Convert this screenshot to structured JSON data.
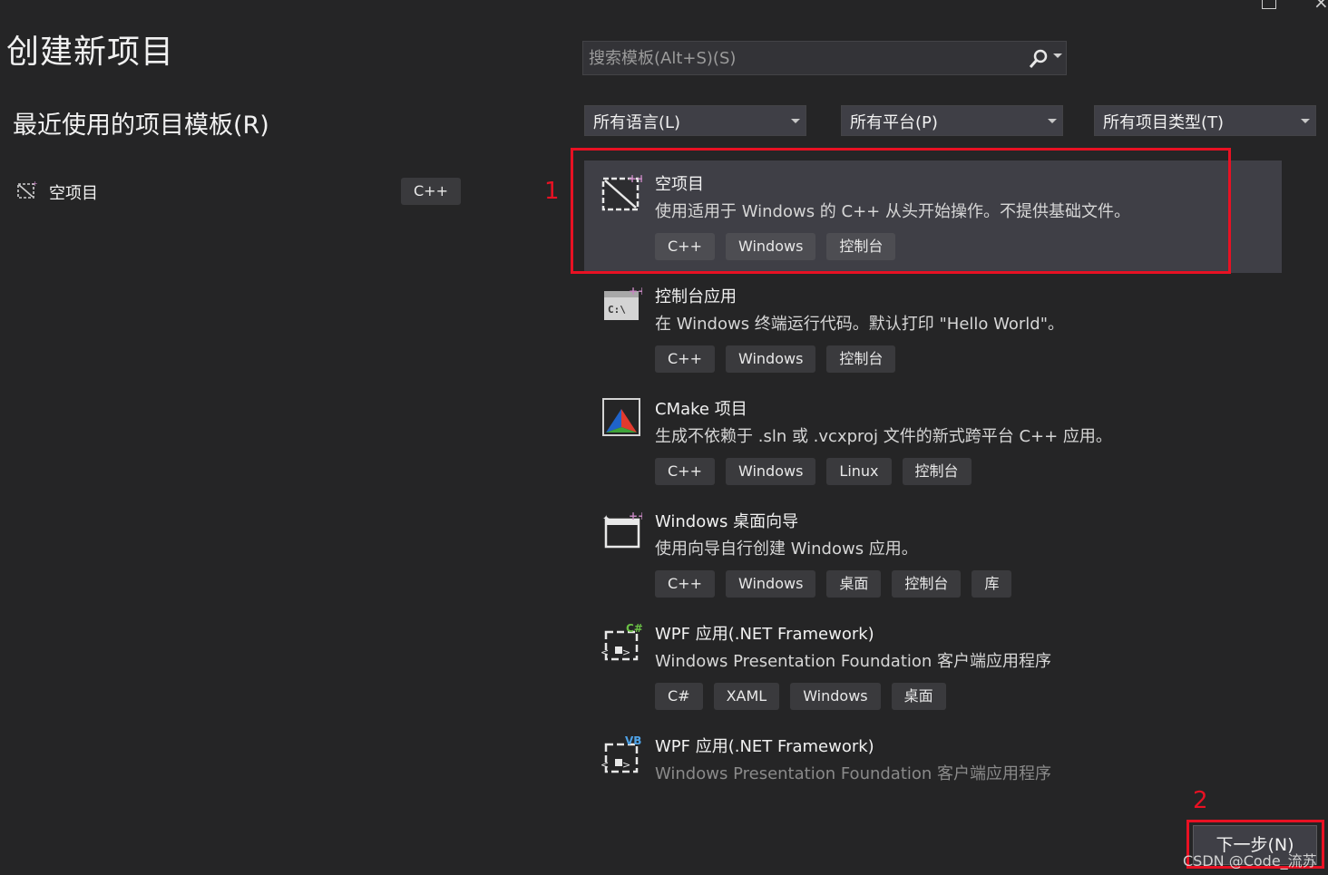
{
  "page_title": "创建新项目",
  "recent": {
    "title": "最近使用的项目模板(R)",
    "items": [
      {
        "label": "空项目",
        "tag": "C++",
        "icon": "empty-project-icon"
      }
    ]
  },
  "search": {
    "placeholder": "搜索模板(Alt+S)(S)",
    "icon": "search-icon"
  },
  "filters": {
    "language": "所有语言(L)",
    "platform": "所有平台(P)",
    "project_type": "所有项目类型(T)"
  },
  "templates": [
    {
      "name": "空项目",
      "desc": "使用适用于 Windows 的 C++ 从头开始操作。不提供基础文件。",
      "tags": [
        "C++",
        "Windows",
        "控制台"
      ],
      "icon": "empty-project-icon",
      "selected": true
    },
    {
      "name": "控制台应用",
      "desc": "在 Windows 终端运行代码。默认打印 \"Hello World\"。",
      "tags": [
        "C++",
        "Windows",
        "控制台"
      ],
      "icon": "console-app-icon"
    },
    {
      "name": "CMake 项目",
      "desc": "生成不依赖于 .sln 或 .vcxproj 文件的新式跨平台 C++ 应用。",
      "tags": [
        "C++",
        "Windows",
        "Linux",
        "控制台"
      ],
      "icon": "cmake-icon"
    },
    {
      "name": "Windows 桌面向导",
      "desc": "使用向导自行创建 Windows 应用。",
      "tags": [
        "C++",
        "Windows",
        "桌面",
        "控制台",
        "库"
      ],
      "icon": "desktop-wizard-icon"
    },
    {
      "name": "WPF 应用(.NET Framework)",
      "desc": "Windows Presentation Foundation 客户端应用程序",
      "tags": [
        "C#",
        "XAML",
        "Windows",
        "桌面"
      ],
      "icon": "wpf-csharp-icon"
    },
    {
      "name": "WPF 应用(.NET Framework)",
      "desc": "Windows Presentation Foundation 客户端应用程序",
      "tags": [],
      "icon": "wpf-vb-icon"
    }
  ],
  "annotations": {
    "one": "1",
    "two": "2"
  },
  "next_button": "下一步(N)",
  "watermark": "CSDN @Code_流苏",
  "colors": {
    "background": "#252526",
    "selected": "#3f3f46",
    "annotation": "#e81123",
    "tag_bg": "#3a3a3d"
  }
}
